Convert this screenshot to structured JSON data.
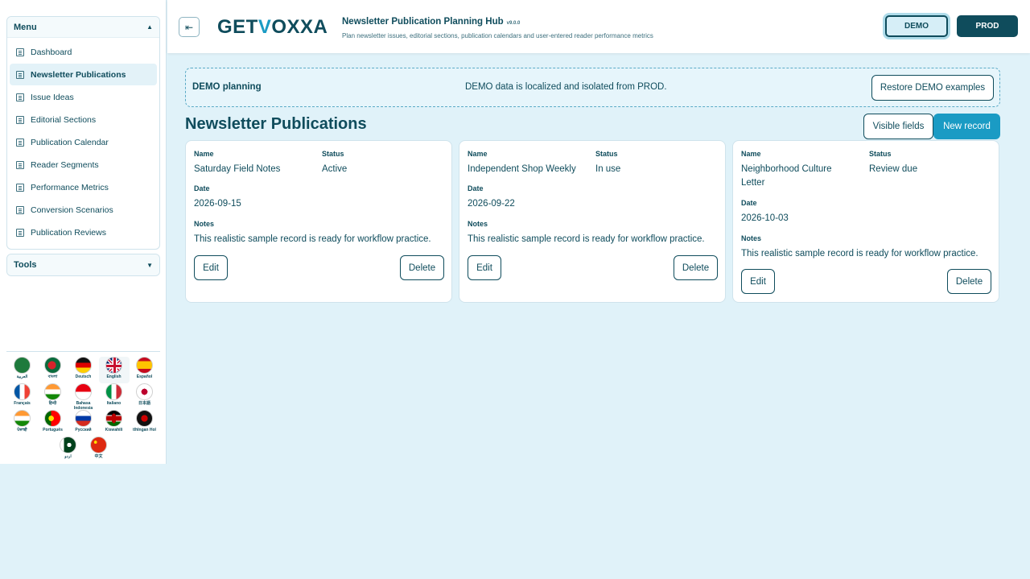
{
  "sidebar": {
    "menu_title": "Menu",
    "tools_title": "Tools",
    "items": [
      {
        "label": "Dashboard"
      },
      {
        "label": "Newsletter Publications"
      },
      {
        "label": "Issue Ideas"
      },
      {
        "label": "Editorial Sections"
      },
      {
        "label": "Publication Calendar"
      },
      {
        "label": "Reader Segments"
      },
      {
        "label": "Performance Metrics"
      },
      {
        "label": "Conversion Scenarios"
      },
      {
        "label": "Publication Reviews"
      }
    ],
    "languages": [
      {
        "label": "العربية"
      },
      {
        "label": "বাংলা"
      },
      {
        "label": "Deutsch"
      },
      {
        "label": "English"
      },
      {
        "label": "Español"
      },
      {
        "label": "Français"
      },
      {
        "label": "हिन्दी"
      },
      {
        "label": "Bahasa Indonesia"
      },
      {
        "label": "Italiano"
      },
      {
        "label": "日本語"
      },
      {
        "label": "ਪੰਜਾਬੀ"
      },
      {
        "label": "Português"
      },
      {
        "label": "Русский"
      },
      {
        "label": "Kiswahili"
      },
      {
        "label": "tlhIngan Hol"
      },
      {
        "label": "اردو"
      },
      {
        "label": "中文"
      }
    ]
  },
  "header": {
    "logo_pre": "GET",
    "logo_v": "V",
    "logo_post": "OXXA",
    "title": "Newsletter Publication Planning Hub",
    "version": "v9.0.0",
    "subtitle": "Plan newsletter issues, editorial sections, publication calendars and user-entered reader performance metrics",
    "demo_label": "DEMO",
    "prod_label": "PROD"
  },
  "banner": {
    "label": "DEMO planning",
    "message": "DEMO data is localized and isolated from PROD.",
    "restore_label": "Restore DEMO examples"
  },
  "main": {
    "title": "Newsletter Publications",
    "visible_fields_label": "Visible fields",
    "new_record_label": "New record",
    "field_labels": {
      "name": "Name",
      "status": "Status",
      "date": "Date",
      "notes": "Notes"
    },
    "edit_label": "Edit",
    "delete_label": "Delete",
    "records": [
      {
        "name": "Saturday Field Notes",
        "status": "Active",
        "date": "2026-09-15",
        "notes": "This realistic sample record is ready for workflow practice."
      },
      {
        "name": "Independent Shop Weekly",
        "status": "In use",
        "date": "2026-09-22",
        "notes": "This realistic sample record is ready for workflow practice."
      },
      {
        "name": "Neighborhood Culture Letter",
        "status": "Review due",
        "date": "2026-10-03",
        "notes": "This realistic sample record is ready for workflow practice."
      }
    ]
  },
  "colors": {
    "primary": "#0f4c5c",
    "accent": "#1a9bc4",
    "background": "#e0f2f9"
  }
}
